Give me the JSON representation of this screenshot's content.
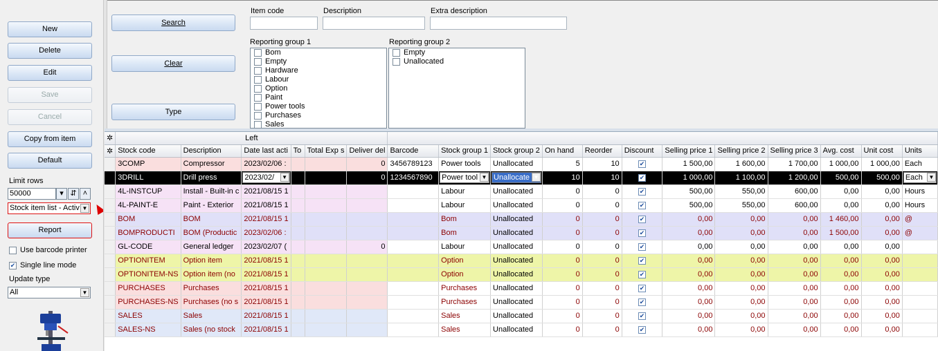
{
  "sidebar": {
    "buttons": {
      "new": "New",
      "delete": "Delete",
      "edit": "Edit",
      "save": "Save",
      "cancel": "Cancel",
      "copy": "Copy from item",
      "default": "Default",
      "report": "Report"
    },
    "limit_rows_label": "Limit rows",
    "limit_rows_value": "50000",
    "report_select": "Stock item list - Activ",
    "use_barcode_label": "Use barcode printer",
    "single_line_label": "Single line mode",
    "update_type_label": "Update type",
    "update_type_value": "All"
  },
  "search": {
    "search_btn": "Search",
    "clear_btn": "Clear",
    "type_btn": "Type",
    "item_code_label": "Item code",
    "description_label": "Description",
    "extra_description_label": "Extra description",
    "reporting_group_1_label": "Reporting group 1",
    "reporting_group_2_label": "Reporting group 2",
    "reporting_group_1": [
      "Bom",
      "Empty",
      "Hardware",
      "Labour",
      "Option",
      "Paint",
      "Power tools",
      "Purchases",
      "Sales"
    ],
    "reporting_group_2": [
      "Empty",
      "Unallocated"
    ]
  },
  "grid": {
    "band_left": "Left",
    "columns": [
      "Stock code",
      "Description",
      "Date last acti",
      "To",
      "Total Exp s",
      "Deliver del",
      "Barcode",
      "Stock group 1",
      "Stock group 2",
      "On hand",
      "Reorder",
      "Discount",
      "Selling price 1",
      "Selling price 2",
      "Selling price 3",
      "Avg. cost",
      "Unit cost",
      "Units"
    ],
    "rows": [
      {
        "color": "#fadede",
        "code": "3COMP",
        "desc": "Compressor",
        "date": "2023/02/06 :",
        "to": "",
        "exp": "",
        "del": "0",
        "barcode": "3456789123",
        "g1": "Power tools",
        "g2": "Unallocated",
        "onhand": "5",
        "reorder": "10",
        "disc": true,
        "sp1": "1 500,00",
        "sp2": "1 600,00",
        "sp3": "1 700,00",
        "avg": "1 000,00",
        "unit": "1 000,00",
        "units": "Each",
        "red": false
      },
      {
        "color": "#000",
        "code": "3DRILL",
        "desc": "Drill press",
        "date": "2023/02/",
        "to": "",
        "exp": "",
        "del": "0",
        "barcode": "1234567890",
        "g1": "Power tool",
        "g2": "Unallocate",
        "onhand": "10",
        "reorder": "10",
        "disc": true,
        "sp1": "1 000,00",
        "sp2": "1 100,00",
        "sp3": "1 200,00",
        "avg": "500,00",
        "unit": "500,00",
        "units": "Each",
        "red": false,
        "selected": true
      },
      {
        "color": "#f6e2f6",
        "code": "4L-INSTCUP",
        "desc": "Install - Built-in c",
        "date": "2021/08/15 1",
        "to": "",
        "exp": "",
        "del": "",
        "barcode": "",
        "g1": "Labour",
        "g2": "Unallocated",
        "onhand": "0",
        "reorder": "0",
        "disc": true,
        "sp1": "500,00",
        "sp2": "550,00",
        "sp3": "600,00",
        "avg": "0,00",
        "unit": "0,00",
        "units": "Hours",
        "red": false
      },
      {
        "color": "#f6e2f6",
        "code": "4L-PAINT-E",
        "desc": "Paint - Exterior",
        "date": "2021/08/15 1",
        "to": "",
        "exp": "",
        "del": "",
        "barcode": "",
        "g1": "Labour",
        "g2": "Unallocated",
        "onhand": "0",
        "reorder": "0",
        "disc": true,
        "sp1": "500,00",
        "sp2": "550,00",
        "sp3": "600,00",
        "avg": "0,00",
        "unit": "0,00",
        "units": "Hours",
        "red": false
      },
      {
        "color": "#e0e0f8",
        "code": "BOM",
        "desc": "BOM",
        "date": "2021/08/15 1",
        "to": "",
        "exp": "",
        "del": "",
        "barcode": "",
        "g1": "Bom",
        "g2": "Unallocated",
        "onhand": "0",
        "reorder": "0",
        "disc": true,
        "sp1": "0,00",
        "sp2": "0,00",
        "sp3": "0,00",
        "avg": "1 460,00",
        "unit": "0,00",
        "units": "@",
        "red": true
      },
      {
        "color": "#e0e0f8",
        "code": "BOMPRODUCTI",
        "desc": "BOM (Productic",
        "date": "2023/02/06 :",
        "to": "",
        "exp": "",
        "del": "",
        "barcode": "",
        "g1": "Bom",
        "g2": "Unallocated",
        "onhand": "0",
        "reorder": "0",
        "disc": true,
        "sp1": "0,00",
        "sp2": "0,00",
        "sp3": "0,00",
        "avg": "1 500,00",
        "unit": "0,00",
        "units": "@",
        "red": true
      },
      {
        "color": "#f6e2f6",
        "code": "GL-CODE",
        "desc": "General ledger",
        "date": "2023/02/07 (",
        "to": "",
        "exp": "",
        "del": "0",
        "barcode": "",
        "g1": "Labour",
        "g2": "Unallocated",
        "onhand": "0",
        "reorder": "0",
        "disc": true,
        "sp1": "0,00",
        "sp2": "0,00",
        "sp3": "0,00",
        "avg": "0,00",
        "unit": "0,00",
        "units": "",
        "red": false
      },
      {
        "color": "#eef5a8",
        "code": "OPTIONITEM",
        "desc": "Option item",
        "date": "2021/08/15 1",
        "to": "",
        "exp": "",
        "del": "",
        "barcode": "",
        "g1": "Option",
        "g2": "Unallocated",
        "onhand": "0",
        "reorder": "0",
        "disc": true,
        "sp1": "0,00",
        "sp2": "0,00",
        "sp3": "0,00",
        "avg": "0,00",
        "unit": "0,00",
        "units": "",
        "red": true
      },
      {
        "color": "#eef5a8",
        "code": "OPTIONITEM-NS",
        "desc": "Option item (no",
        "date": "2021/08/15 1",
        "to": "",
        "exp": "",
        "del": "",
        "barcode": "",
        "g1": "Option",
        "g2": "Unallocated",
        "onhand": "0",
        "reorder": "0",
        "disc": true,
        "sp1": "0,00",
        "sp2": "0,00",
        "sp3": "0,00",
        "avg": "0,00",
        "unit": "0,00",
        "units": "",
        "red": true
      },
      {
        "color": "#fadede",
        "code": "PURCHASES",
        "desc": "Purchases",
        "date": "2021/08/15 1",
        "to": "",
        "exp": "",
        "del": "",
        "barcode": "",
        "g1": "Purchases",
        "g2": "Unallocated",
        "onhand": "0",
        "reorder": "0",
        "disc": true,
        "sp1": "0,00",
        "sp2": "0,00",
        "sp3": "0,00",
        "avg": "0,00",
        "unit": "0,00",
        "units": "",
        "red": true
      },
      {
        "color": "#fadede",
        "code": "PURCHASES-NS",
        "desc": "Purchases (no s",
        "date": "2021/08/15 1",
        "to": "",
        "exp": "",
        "del": "",
        "barcode": "",
        "g1": "Purchases",
        "g2": "Unallocated",
        "onhand": "0",
        "reorder": "0",
        "disc": true,
        "sp1": "0,00",
        "sp2": "0,00",
        "sp3": "0,00",
        "avg": "0,00",
        "unit": "0,00",
        "units": "",
        "red": true
      },
      {
        "color": "#e0e8f8",
        "code": "SALES",
        "desc": "Sales",
        "date": "2021/08/15 1",
        "to": "",
        "exp": "",
        "del": "",
        "barcode": "",
        "g1": "Sales",
        "g2": "Unallocated",
        "onhand": "0",
        "reorder": "0",
        "disc": true,
        "sp1": "0,00",
        "sp2": "0,00",
        "sp3": "0,00",
        "avg": "0,00",
        "unit": "0,00",
        "units": "",
        "red": true
      },
      {
        "color": "#e0e8f8",
        "code": "SALES-NS",
        "desc": "Sales (no stock",
        "date": "2021/08/15 1",
        "to": "",
        "exp": "",
        "del": "",
        "barcode": "",
        "g1": "Sales",
        "g2": "Unallocated",
        "onhand": "0",
        "reorder": "0",
        "disc": true,
        "sp1": "0,00",
        "sp2": "0,00",
        "sp3": "0,00",
        "avg": "0,00",
        "unit": "0,00",
        "units": "",
        "red": true
      }
    ]
  }
}
